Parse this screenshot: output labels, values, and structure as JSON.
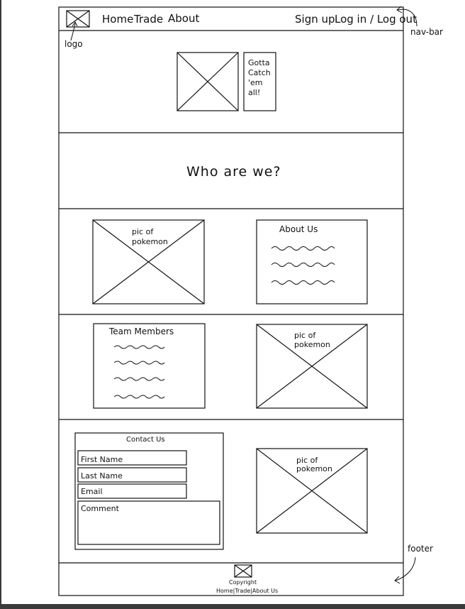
{
  "nav": {
    "home": "Home",
    "trade": "Trade",
    "about": "About",
    "sign_up": "Sign up",
    "log_in_out": "Log in / Log out"
  },
  "annotations": {
    "logo": "logo",
    "nav_bar": "nav-bar",
    "footer": "footer"
  },
  "hero": {
    "tagline_lines": [
      "Gotta",
      "Catch",
      "'em",
      "all!"
    ]
  },
  "who": {
    "heading": "Who are we?"
  },
  "about_section": {
    "pic_label_lines": [
      "pic of",
      "pokemon"
    ],
    "about_title": "About Us"
  },
  "team_section": {
    "team_title": "Team Members",
    "pic_label_lines": [
      "pic of",
      "pokemon"
    ]
  },
  "contact_section": {
    "title": "Contact Us",
    "first_name": "First Name",
    "last_name": "Last Name",
    "email": "Email",
    "comment": "Comment",
    "pic_label_lines": [
      "pic of",
      "pokemon"
    ]
  },
  "footer": {
    "copyright": "Copyright",
    "links": "Home|Trade|About Us"
  },
  "colors": {
    "ink": "#111111",
    "background": "#ffffff",
    "frame_edge": "#3a3a3a"
  }
}
